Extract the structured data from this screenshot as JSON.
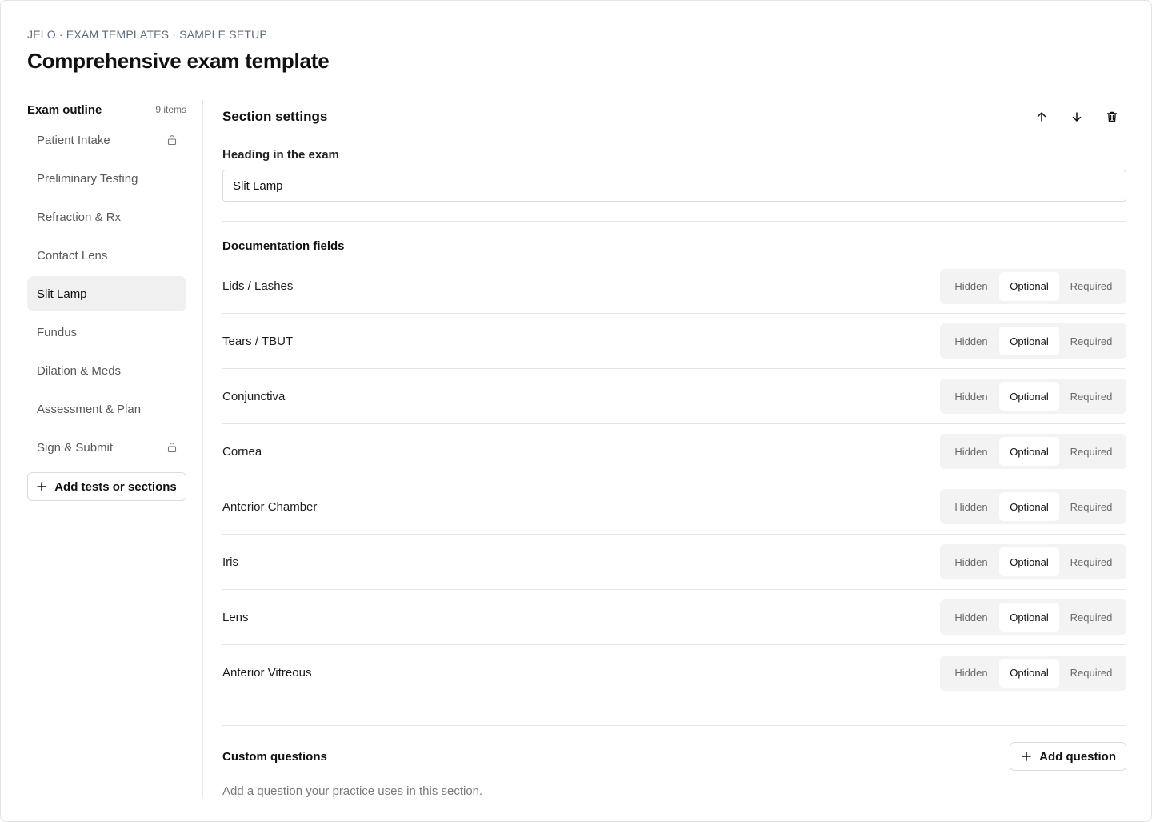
{
  "breadcrumb": "JELO · EXAM TEMPLATES · SAMPLE SETUP",
  "page_title": "Comprehensive exam template",
  "sidebar": {
    "title": "Exam outline",
    "count": "9 items",
    "items": [
      {
        "label": "Patient Intake",
        "locked": true,
        "active": false
      },
      {
        "label": "Preliminary Testing",
        "locked": false,
        "active": false
      },
      {
        "label": "Refraction & Rx",
        "locked": false,
        "active": false
      },
      {
        "label": "Contact Lens",
        "locked": false,
        "active": false
      },
      {
        "label": "Slit Lamp",
        "locked": false,
        "active": true
      },
      {
        "label": "Fundus",
        "locked": false,
        "active": false
      },
      {
        "label": "Dilation & Meds",
        "locked": false,
        "active": false
      },
      {
        "label": "Assessment & Plan",
        "locked": false,
        "active": false
      },
      {
        "label": "Sign & Submit",
        "locked": true,
        "active": false
      }
    ],
    "add_button": "Add tests or sections"
  },
  "section": {
    "title": "Section settings",
    "heading_label": "Heading in the exam",
    "heading_value": "Slit Lamp",
    "doc_title": "Documentation fields",
    "options": [
      "Hidden",
      "Optional",
      "Required"
    ],
    "fields": [
      {
        "label": "Lids / Lashes",
        "value": "Optional"
      },
      {
        "label": "Tears / TBUT",
        "value": "Optional"
      },
      {
        "label": "Conjunctiva",
        "value": "Optional"
      },
      {
        "label": "Cornea",
        "value": "Optional"
      },
      {
        "label": "Anterior Chamber",
        "value": "Optional"
      },
      {
        "label": "Iris",
        "value": "Optional"
      },
      {
        "label": "Lens",
        "value": "Optional"
      },
      {
        "label": "Anterior Vitreous",
        "value": "Optional"
      }
    ],
    "custom_title": "Custom questions",
    "add_question": "Add question",
    "custom_help": "Add a question your practice uses in this section."
  },
  "icons": {
    "move_up": "arrow-up-icon",
    "move_down": "arrow-down-icon",
    "delete": "trash-icon",
    "lock": "lock-icon",
    "plus": "plus-icon"
  }
}
